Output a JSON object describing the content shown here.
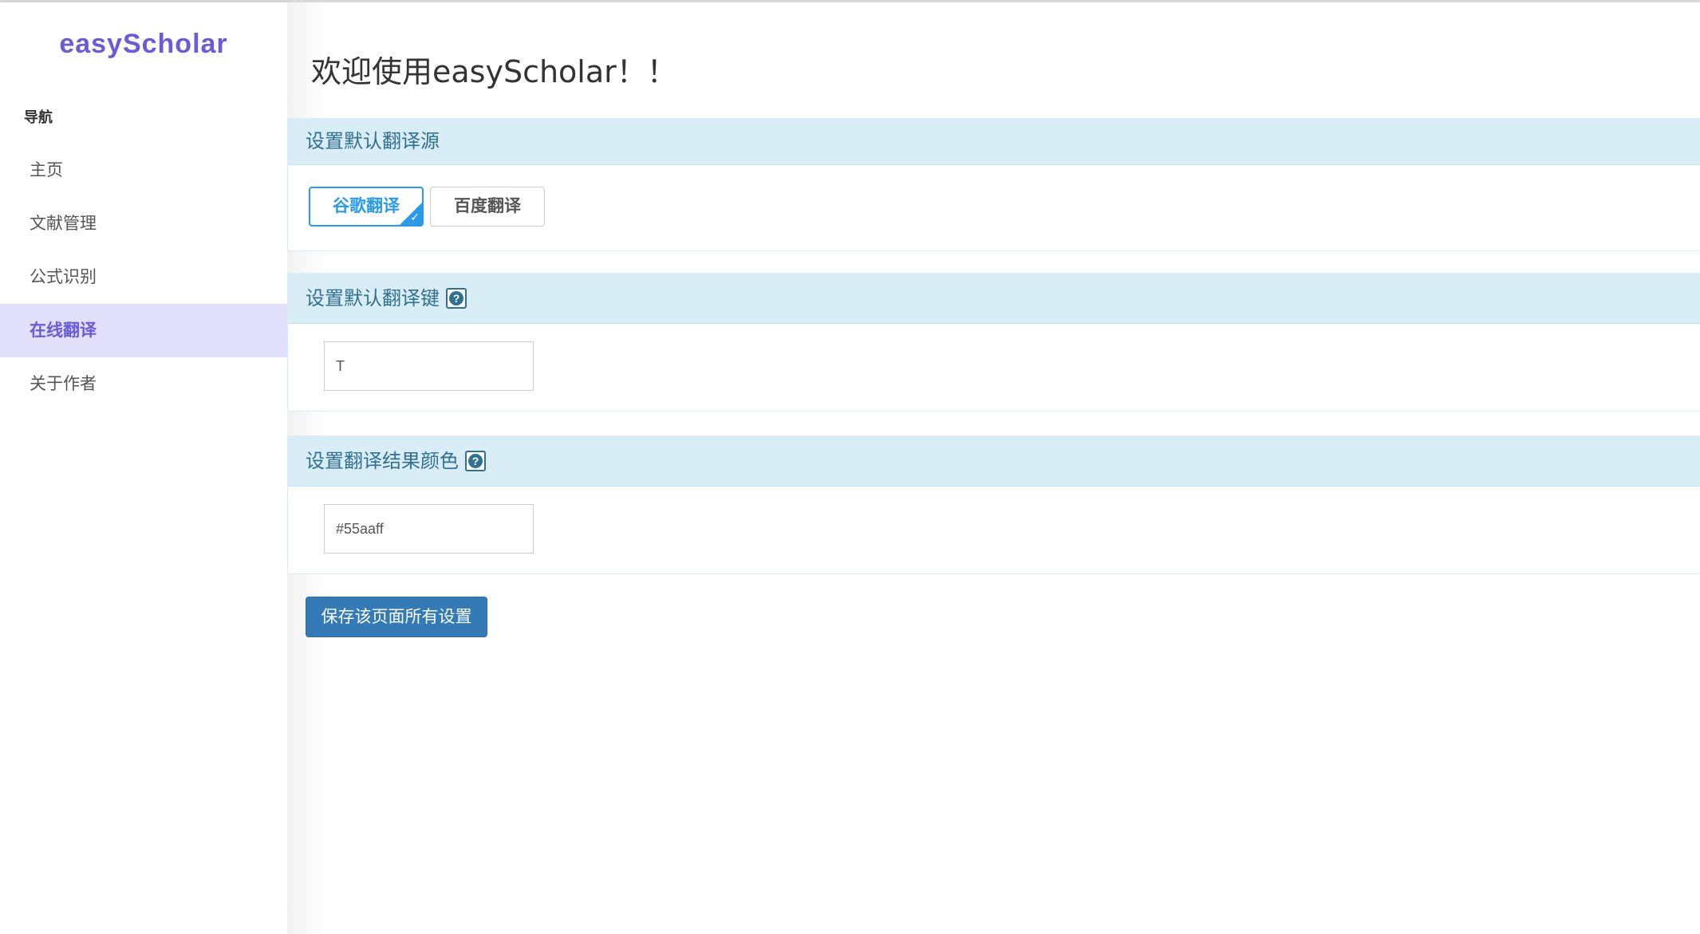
{
  "app": {
    "brand": "easyScholar"
  },
  "sidebar": {
    "heading": "导航",
    "items": [
      {
        "label": "主页",
        "active": false
      },
      {
        "label": "文献管理",
        "active": false
      },
      {
        "label": "公式识别",
        "active": false
      },
      {
        "label": "在线翻译",
        "active": true
      },
      {
        "label": "关于作者",
        "active": false
      }
    ]
  },
  "main": {
    "title": "欢迎使用easyScholar！！",
    "sections": {
      "translate_source": {
        "heading": "设置默认翻译源",
        "options": [
          {
            "label": "谷歌翻译",
            "selected": true
          },
          {
            "label": "百度翻译",
            "selected": false
          }
        ]
      },
      "translate_key": {
        "heading": "设置默认翻译键",
        "help_icon": "question-icon",
        "value": "T"
      },
      "result_color": {
        "heading": "设置翻译结果颜色",
        "help_icon": "question-icon",
        "value": "#55aaff"
      }
    },
    "save_label": "保存该页面所有设置"
  },
  "colors": {
    "brand": "#6a5bd8",
    "active_bg": "#e2dffb",
    "panel_heading_bg": "#d9edf7",
    "panel_heading_text": "#31708f",
    "selected_accent": "#2a9be8",
    "primary_button": "#337ab7"
  }
}
